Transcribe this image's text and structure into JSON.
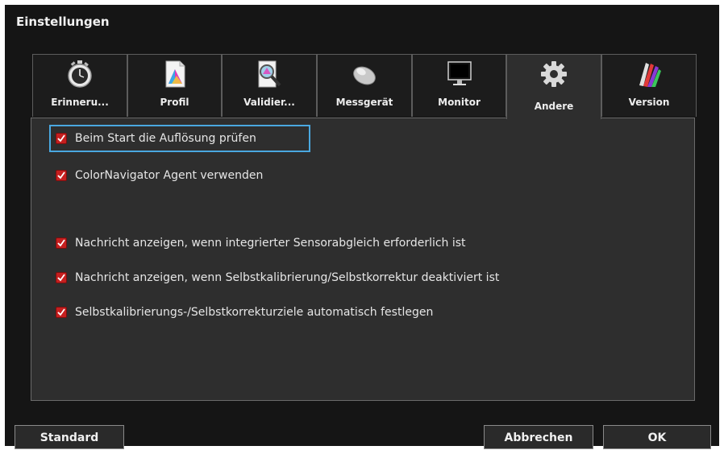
{
  "window": {
    "title": "Einstellungen"
  },
  "tabs": [
    {
      "id": "erinnerung",
      "label": "Erinneru...",
      "icon": "stopwatch-icon",
      "active": false
    },
    {
      "id": "profil",
      "label": "Profil",
      "icon": "color-profile-document-icon",
      "active": false
    },
    {
      "id": "validierung",
      "label": "Validier...",
      "icon": "magnifier-validation-icon",
      "active": false
    },
    {
      "id": "messgeraet",
      "label": "Messgerät",
      "icon": "sensor-device-icon",
      "active": false
    },
    {
      "id": "monitor",
      "label": "Monitor",
      "icon": "monitor-icon",
      "active": false
    },
    {
      "id": "andere",
      "label": "Andere",
      "icon": "gear-icon",
      "active": true
    },
    {
      "id": "version",
      "label": "Version",
      "icon": "color-spectrum-icon",
      "active": false
    }
  ],
  "options": [
    {
      "label": "Beim Start die Auflösung prüfen",
      "checked": true,
      "focused": true
    },
    {
      "label": "ColorNavigator Agent verwenden",
      "checked": true
    },
    {
      "label": "Nachricht anzeigen, wenn integrierter Sensorabgleich erforderlich ist",
      "checked": true
    },
    {
      "label": "Nachricht anzeigen, wenn Selbstkalibrierung/Selbstkorrektur deaktiviert ist",
      "checked": true
    },
    {
      "label": "Selbstkalibrierungs-/Selbstkorrekturziele automatisch festlegen",
      "checked": true
    }
  ],
  "buttons": {
    "standard": "Standard",
    "cancel": "Abbrechen",
    "ok": "OK"
  },
  "colors": {
    "window_bg": "#151515",
    "panel_bg": "#2e2e2e",
    "checkbox": "#c51f1f",
    "focus_ring": "#4aa8e0"
  }
}
